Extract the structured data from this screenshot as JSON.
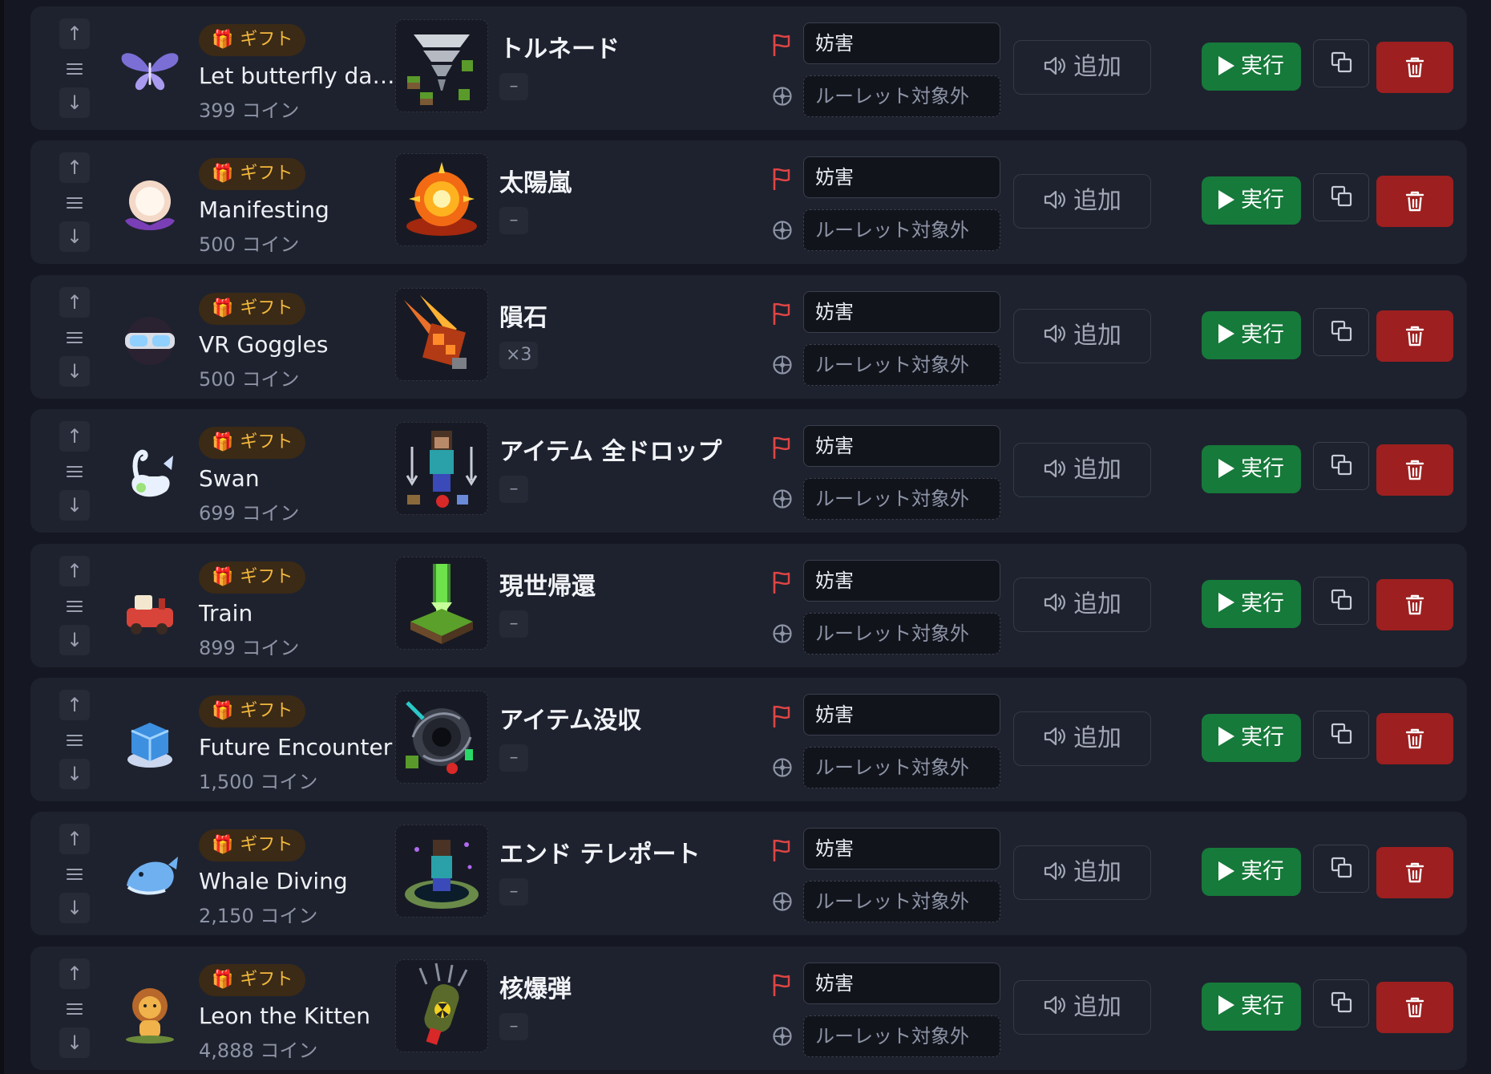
{
  "labels": {
    "gift_badge": "ギフト",
    "add_sound": "追加",
    "run": "実行"
  },
  "colors": {
    "row_bg": "#1e222e",
    "page_bg": "#151822",
    "gift_badge_text": "#f3b83c",
    "run_green": "#167a3a",
    "delete_red": "#9d1f1f",
    "flag_red": "#e04545"
  },
  "rows": [
    {
      "gift_name": "Let butterfly da…",
      "gift_price": "399 コイン",
      "gift_icon": "butterfly-icon",
      "action_name": "トルネード",
      "action_count": "–",
      "action_icon": "tornado-icon",
      "category": "妨害",
      "roulette": "ルーレット対象外"
    },
    {
      "gift_name": "Manifesting",
      "gift_price": "500 コイン",
      "gift_icon": "crystal-ball-icon",
      "action_name": "太陽嵐",
      "action_count": "–",
      "action_icon": "solar-storm-icon",
      "category": "妨害",
      "roulette": "ルーレット対象外"
    },
    {
      "gift_name": "VR Goggles",
      "gift_price": "500 コイン",
      "gift_icon": "vr-goggles-icon",
      "action_name": "隕石",
      "action_count": "×3",
      "action_icon": "meteor-icon",
      "category": "妨害",
      "roulette": "ルーレット対象外"
    },
    {
      "gift_name": "Swan",
      "gift_price": "699 コイン",
      "gift_icon": "swan-icon",
      "action_name": "アイテム 全ドロップ",
      "action_count": "–",
      "action_icon": "item-drop-icon",
      "category": "妨害",
      "roulette": "ルーレット対象外"
    },
    {
      "gift_name": "Train",
      "gift_price": "899 コイン",
      "gift_icon": "train-icon",
      "action_name": "現世帰還",
      "action_count": "–",
      "action_icon": "respawn-beam-icon",
      "category": "妨害",
      "roulette": "ルーレット対象外"
    },
    {
      "gift_name": "Future Encounter",
      "gift_price": "1,500 コイン",
      "gift_icon": "future-encounter-icon",
      "action_name": "アイテム没収",
      "action_count": "–",
      "action_icon": "item-vortex-icon",
      "category": "妨害",
      "roulette": "ルーレット対象外"
    },
    {
      "gift_name": "Whale Diving",
      "gift_price": "2,150 コイン",
      "gift_icon": "whale-icon",
      "action_name": "エンド テレポート",
      "action_count": "–",
      "action_icon": "end-portal-icon",
      "category": "妨害",
      "roulette": "ルーレット対象外"
    },
    {
      "gift_name": "Leon the Kitten",
      "gift_price": "4,888 コイン",
      "gift_icon": "lion-icon",
      "action_name": "核爆弾",
      "action_count": "–",
      "action_icon": "nuke-icon",
      "category": "妨害",
      "roulette": "ルーレット対象外"
    }
  ]
}
